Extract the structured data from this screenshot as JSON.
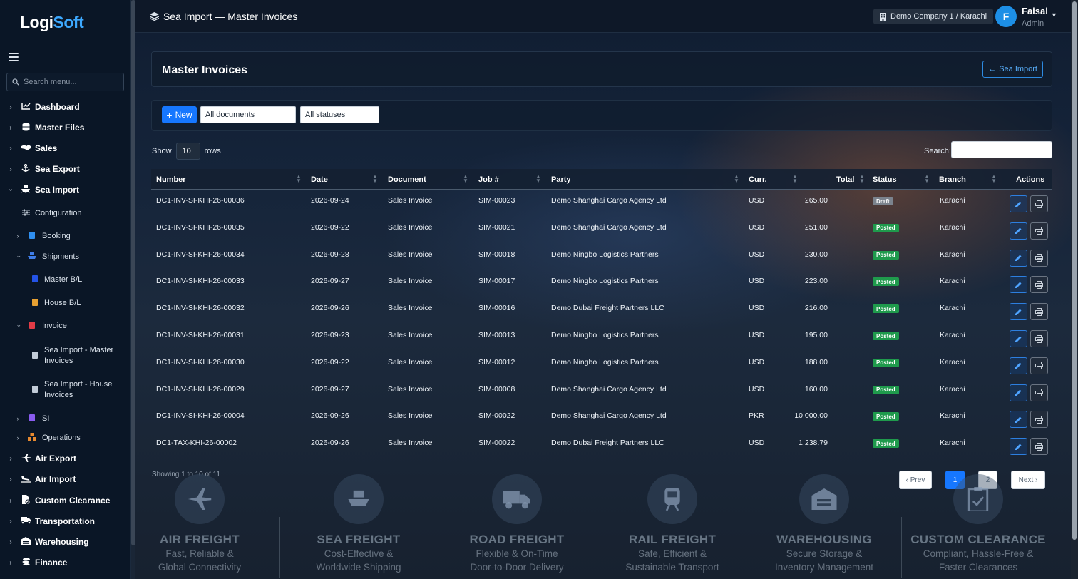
{
  "app": {
    "logo_a": "Logi",
    "logo_b": "Soft"
  },
  "sidebar": {
    "search_placeholder": "Search menu...",
    "top_items": [
      {
        "label": "Dashboard",
        "icon": "chart-icon"
      },
      {
        "label": "Master Files",
        "icon": "database-icon"
      },
      {
        "label": "Sales",
        "icon": "handshake-icon"
      },
      {
        "label": "Sea Export",
        "icon": "anchor-icon"
      },
      {
        "label": "Sea Import",
        "icon": "ship-icon"
      }
    ],
    "sea_import_children": {
      "configuration": "Configuration",
      "booking": "Booking",
      "shipments": "Shipments",
      "master_bl": "Master B/L",
      "house_bl": "House B/L",
      "invoice": "Invoice",
      "sea_import_master_invoices_1": "Sea Import - Master",
      "sea_import_master_invoices_2": "Invoices",
      "sea_import_house_invoices_1": "Sea Import - House",
      "sea_import_house_invoices_2": "Invoices",
      "si": "SI",
      "operations": "Operations"
    },
    "bottom_items": [
      {
        "label": "Air Export",
        "icon": "plane-icon"
      },
      {
        "label": "Air Import",
        "icon": "plane-landing-icon"
      },
      {
        "label": "Custom Clearance",
        "icon": "file-check-icon"
      },
      {
        "label": "Transportation",
        "icon": "truck-icon"
      },
      {
        "label": "Warehousing",
        "icon": "warehouse-icon"
      },
      {
        "label": "Finance",
        "icon": "coins-icon"
      }
    ]
  },
  "topbar": {
    "title": "Sea Import — Master Invoices",
    "company": "Demo Company 1 / Karachi",
    "user_initial": "F",
    "user_name": "Faisal",
    "user_role": "Admin"
  },
  "page": {
    "heading": "Master Invoices",
    "back_label": "Sea Import",
    "new_label": "New",
    "filter_documents": "All documents",
    "filter_statuses": "All statuses",
    "show_label": "Show",
    "rows_value": "10",
    "rows_label": "rows",
    "search_label": "Search:",
    "showing": "Showing 1 to 10 of 11",
    "pager": {
      "prev": "‹ Prev",
      "p1": "1",
      "p2": "2",
      "next": "Next ›"
    }
  },
  "table": {
    "headers": {
      "number": "Number",
      "date": "Date",
      "document": "Document",
      "job": "Job #",
      "party": "Party",
      "curr": "Curr.",
      "total": "Total",
      "status": "Status",
      "branch": "Branch",
      "actions": "Actions"
    },
    "rows": [
      {
        "number": "DC1-INV-SI-KHI-26-00036",
        "date": "2026-09-24",
        "document": "Sales Invoice",
        "job": "SIM-00023",
        "party": "Demo Shanghai Cargo Agency Ltd",
        "curr": "USD",
        "total": "265.00",
        "status": "Draft",
        "branch": "Karachi"
      },
      {
        "number": "DC1-INV-SI-KHI-26-00035",
        "date": "2026-09-22",
        "document": "Sales Invoice",
        "job": "SIM-00021",
        "party": "Demo Shanghai Cargo Agency Ltd",
        "curr": "USD",
        "total": "251.00",
        "status": "Posted",
        "branch": "Karachi"
      },
      {
        "number": "DC1-INV-SI-KHI-26-00034",
        "date": "2026-09-28",
        "document": "Sales Invoice",
        "job": "SIM-00018",
        "party": "Demo Ningbo Logistics Partners",
        "curr": "USD",
        "total": "230.00",
        "status": "Posted",
        "branch": "Karachi"
      },
      {
        "number": "DC1-INV-SI-KHI-26-00033",
        "date": "2026-09-27",
        "document": "Sales Invoice",
        "job": "SIM-00017",
        "party": "Demo Ningbo Logistics Partners",
        "curr": "USD",
        "total": "223.00",
        "status": "Posted",
        "branch": "Karachi"
      },
      {
        "number": "DC1-INV-SI-KHI-26-00032",
        "date": "2026-09-26",
        "document": "Sales Invoice",
        "job": "SIM-00016",
        "party": "Demo Dubai Freight Partners LLC",
        "curr": "USD",
        "total": "216.00",
        "status": "Posted",
        "branch": "Karachi"
      },
      {
        "number": "DC1-INV-SI-KHI-26-00031",
        "date": "2026-09-23",
        "document": "Sales Invoice",
        "job": "SIM-00013",
        "party": "Demo Ningbo Logistics Partners",
        "curr": "USD",
        "total": "195.00",
        "status": "Posted",
        "branch": "Karachi"
      },
      {
        "number": "DC1-INV-SI-KHI-26-00030",
        "date": "2026-09-22",
        "document": "Sales Invoice",
        "job": "SIM-00012",
        "party": "Demo Ningbo Logistics Partners",
        "curr": "USD",
        "total": "188.00",
        "status": "Posted",
        "branch": "Karachi"
      },
      {
        "number": "DC1-INV-SI-KHI-26-00029",
        "date": "2026-09-27",
        "document": "Sales Invoice",
        "job": "SIM-00008",
        "party": "Demo Shanghai Cargo Agency Ltd",
        "curr": "USD",
        "total": "160.00",
        "status": "Posted",
        "branch": "Karachi"
      },
      {
        "number": "DC1-INV-SI-KHI-26-00004",
        "date": "2026-09-26",
        "document": "Sales Invoice",
        "job": "SIM-00022",
        "party": "Demo Shanghai Cargo Agency Ltd",
        "curr": "PKR",
        "total": "10,000.00",
        "status": "Posted",
        "branch": "Karachi"
      },
      {
        "number": "DC1-TAX-KHI-26-00002",
        "date": "2026-09-26",
        "document": "Sales Invoice",
        "job": "SIM-00022",
        "party": "Demo Dubai Freight Partners LLC",
        "curr": "USD",
        "total": "1,238.79",
        "status": "Posted",
        "branch": "Karachi"
      }
    ]
  },
  "services": [
    {
      "name": "AIR FREIGHT",
      "l1": "Fast, Reliable &",
      "l2": "Global Connectivity",
      "icon": "plane-icon"
    },
    {
      "name": "SEA FREIGHT",
      "l1": "Cost-Effective &",
      "l2": "Worldwide Shipping",
      "icon": "ship-icon"
    },
    {
      "name": "ROAD FREIGHT",
      "l1": "Flexible & On-Time",
      "l2": "Door-to-Door Delivery",
      "icon": "truck-icon"
    },
    {
      "name": "RAIL FREIGHT",
      "l1": "Safe, Efficient &",
      "l2": "Sustainable Transport",
      "icon": "train-icon"
    },
    {
      "name": "WAREHOUSING",
      "l1": "Secure Storage &",
      "l2": "Inventory Management",
      "icon": "warehouse-icon"
    },
    {
      "name": "CUSTOM CLEARANCE",
      "l1": "Compliant, Hassle-Free &",
      "l2": "Faster Clearances",
      "icon": "clipboard-check-icon"
    }
  ],
  "colors": {
    "accent": "#1677ff",
    "posted": "#1f9a4c",
    "draft": "#7b838d",
    "sidebar_bg": "#0a1626"
  }
}
